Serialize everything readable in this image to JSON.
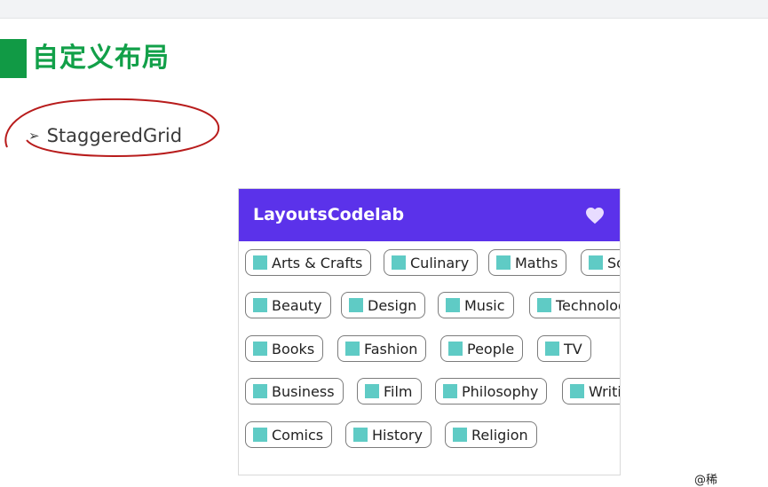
{
  "slide": {
    "title": "自定义布局",
    "bullet": "StaggeredGrid",
    "accent": "#12a049",
    "circle_color": "#b81c1c"
  },
  "app": {
    "title": "LayoutsCodelab",
    "appbar_color": "#5b32ea",
    "swatch_color": "#5fcbc5",
    "heart_icon": "favorite-icon",
    "rows": [
      [
        "Arts & Crafts",
        "Culinary",
        "Maths",
        "So"
      ],
      [
        "Beauty",
        "Design",
        "Music",
        "Technolog"
      ],
      [
        "Books",
        "Fashion",
        "People",
        "TV"
      ],
      [
        "Business",
        "Film",
        "Philosophy",
        "Writi"
      ],
      [
        "Comics",
        "History",
        "Religion"
      ]
    ]
  },
  "footer": {
    "corner_text": "@稀"
  }
}
